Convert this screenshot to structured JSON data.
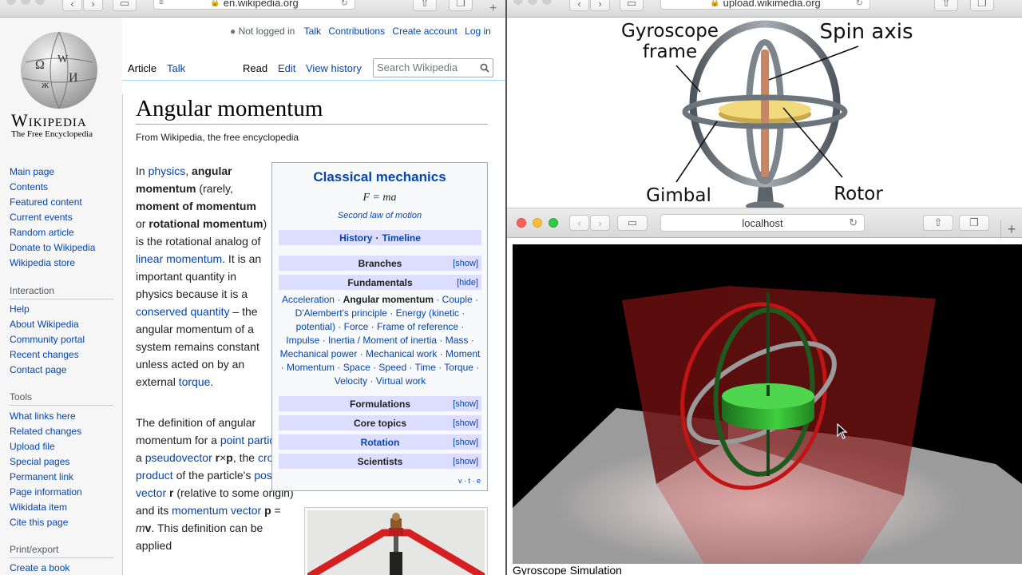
{
  "left_window": {
    "url": "en.wikipedia.org",
    "logo": {
      "wordmark": "Wikipedia",
      "tagline": "The Free Encyclopedia"
    },
    "personal": {
      "not_logged_in": "Not logged in",
      "talk": "Talk",
      "contributions": "Contributions",
      "create_account": "Create account",
      "log_in": "Log in"
    },
    "tabs": {
      "article": "Article",
      "talk": "Talk",
      "read": "Read",
      "edit": "Edit",
      "history": "View history"
    },
    "search": {
      "placeholder": "Search Wikipedia"
    },
    "nav": {
      "main": [
        "Main page",
        "Contents",
        "Featured content",
        "Current events",
        "Random article",
        "Donate to Wikipedia",
        "Wikipedia store"
      ],
      "interaction_heading": "Interaction",
      "interaction": [
        "Help",
        "About Wikipedia",
        "Community portal",
        "Recent changes",
        "Contact page"
      ],
      "tools_heading": "Tools",
      "tools": [
        "What links here",
        "Related changes",
        "Upload file",
        "Special pages",
        "Permanent link",
        "Page information",
        "Wikidata item",
        "Cite this page"
      ],
      "print_heading": "Print/export",
      "print": [
        "Create a book"
      ]
    },
    "article": {
      "title": "Angular momentum",
      "tagline": "From Wikipedia, the free encyclopedia"
    },
    "infobox": {
      "title": "Classical mechanics",
      "formula": "F = ma",
      "formula_caption": "Second law of motion",
      "history": "History",
      "timeline": "Timeline",
      "sections": [
        {
          "label": "Branches",
          "toggle": "[show]"
        },
        {
          "label": "Fundamentals",
          "toggle": "[hide]"
        }
      ],
      "fundamentals": [
        "Acceleration",
        "Angular momentum",
        "Couple",
        "D'Alembert's principle",
        "Energy",
        "kinetic",
        "potential",
        "Force",
        "Frame of reference",
        "Impulse",
        "Inertia / Moment of inertia",
        "Mass",
        "Mechanical power",
        "Mechanical work",
        "Moment",
        "Momentum",
        "Space",
        "Speed",
        "Time",
        "Torque",
        "Velocity",
        "Virtual work"
      ],
      "more_sections": [
        {
          "label": "Formulations",
          "toggle": "[show]"
        },
        {
          "label": "Core topics",
          "toggle": "[show]"
        },
        {
          "label": "Rotation",
          "toggle": "[show]"
        },
        {
          "label": "Scientists",
          "toggle": "[show]"
        }
      ],
      "vte": "v · t · e"
    }
  },
  "diagram_window": {
    "url": "upload.wikimedia.org",
    "labels": {
      "frame": "Gyroscope frame",
      "spin_axis": "Spin axis",
      "gimbal": "Gimbal",
      "rotor": "Rotor"
    }
  },
  "sim_window": {
    "url": "localhost",
    "caption": "Gyroscope Simulation"
  }
}
